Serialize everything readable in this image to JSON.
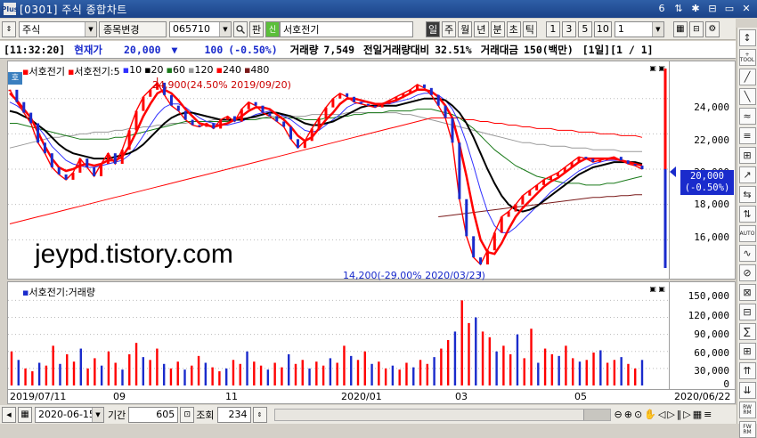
{
  "window": {
    "title": "[0301] 주식 종합차트",
    "logo": "Plus",
    "buttons": [
      "6",
      "⇅",
      "✱",
      "⊟",
      "▭",
      "✕"
    ]
  },
  "toolbar": {
    "market": "주식",
    "stock_change_label": "종목변경",
    "code": "065710",
    "pan_label": "판",
    "sin_label": "신",
    "stock_name": "서호전기",
    "periods": [
      "일",
      "주",
      "월",
      "년",
      "분",
      "초",
      "틱"
    ],
    "active_period": "일",
    "numbers": [
      "1",
      "3",
      "5",
      "10"
    ],
    "interval_value": "1"
  },
  "info": {
    "time": "[11:32:20]",
    "price_label": "현재가",
    "price": "20,000",
    "change_arrow": "▼",
    "change": "100",
    "change_pct": "(-0.50%)",
    "volume_label": "거래량",
    "volume": "7,549",
    "prev_vol_label": "전일거래량대비",
    "prev_vol_pct": "32.51%",
    "amount_label": "거래대금",
    "amount": "150(백만)",
    "page": "[1일][1 / 1]"
  },
  "legend": {
    "stock1": "서호전기",
    "stock2": "서호전기:5",
    "ma": [
      {
        "label": "10",
        "color": "#3030ff"
      },
      {
        "label": "20",
        "color": "#000000"
      },
      {
        "label": "60",
        "color": "#1a7a1a"
      },
      {
        "label": "120",
        "color": "#999999"
      },
      {
        "label": "240",
        "color": "#ff0000"
      },
      {
        "label": "480",
        "color": "#7a1a1a"
      }
    ],
    "ho_label": "호"
  },
  "annotations": {
    "high": "24,900(24.50% 2019/09/20)",
    "low": "14,200(-29.00% 2020/03/23)"
  },
  "current_badge": {
    "price": "20,000",
    "pct": "(-0.50%)"
  },
  "price_axis": [
    "24,000",
    "22,000",
    "20,000",
    "18,000",
    "16,000"
  ],
  "volume_panel": {
    "title": "서호전기:거래량",
    "axis": [
      "150,000",
      "120,000",
      "90,000",
      "60,000",
      "30,000",
      "0"
    ]
  },
  "date_axis": [
    "2019/07/11",
    "09",
    "11",
    "2020/01",
    "03",
    "05",
    "2020/06/22"
  ],
  "watermark": "jeypd.tistory.com",
  "bottom": {
    "date": "2020-06-15",
    "period_label": "기간",
    "period_value": "605",
    "view_label": "조회",
    "view_value": "234"
  },
  "rightbar": [
    "↕",
    "+ TOOL",
    "╱",
    "╲",
    "≈",
    "≡",
    "⊞",
    "↗",
    "⇆",
    "⇅",
    "AUTO",
    "∿",
    "⊘",
    "⊠",
    "⊟",
    "∑",
    "⊞",
    "⇈",
    "⇊",
    "RW RM",
    "FW RM",
    "⊕",
    "⊖"
  ],
  "chart_data": {
    "type": "candlestick",
    "series": [
      {
        "name": "서호전기",
        "values": [
          24500,
          23800,
          23200,
          22600,
          21500,
          20900,
          20100,
          19700,
          19400,
          19800,
          20600,
          20100,
          19600,
          20300,
          20900,
          20300,
          21100,
          22200,
          23300,
          24100,
          24500,
          24900,
          24200,
          23600,
          23300,
          22800,
          22500,
          22400,
          22600,
          22300,
          22800,
          23000,
          22700,
          23400,
          23800,
          23600,
          23200,
          23000,
          22700,
          22400,
          21700,
          21200,
          21600,
          22300,
          22900,
          23500,
          24000,
          24300,
          24100,
          23800,
          23700,
          23600,
          23500,
          23700,
          23900,
          24100,
          24300,
          24500,
          24800,
          24600,
          24200,
          23600,
          22900,
          21500,
          18300,
          16200,
          15000,
          14600,
          15400,
          16400,
          17300,
          17600,
          18000,
          18500,
          18800,
          19100,
          19400,
          19600,
          19800,
          20100,
          20400,
          20700,
          20600,
          20400,
          20500,
          20600,
          20700,
          20500,
          20300,
          20200,
          20000
        ]
      },
      {
        "name": "서호전기:5",
        "values": [
          24300,
          23900,
          23400,
          22900,
          22100,
          21300,
          20600,
          20100,
          19900,
          20000,
          20200,
          20300,
          20200,
          20300,
          20500,
          20500,
          20700,
          21300,
          22100,
          23000,
          23700,
          24300,
          24500,
          24300,
          23900,
          23400,
          23000,
          22600,
          22500,
          22400,
          22500,
          22600,
          22800,
          23000,
          23300,
          23500,
          23500,
          23400,
          23100,
          22800,
          22400,
          21900,
          21600,
          21800,
          22300,
          22800,
          23200,
          23700,
          24000,
          24000,
          23900,
          23800,
          23700,
          23700,
          23800,
          23900,
          24100,
          24300,
          24500,
          24500,
          24400,
          24100,
          23600,
          22900,
          21400,
          19600,
          17600,
          16000,
          15300,
          15200,
          15800,
          16600,
          17300,
          17800,
          18200,
          18600,
          19000,
          19300,
          19500,
          19800,
          20100,
          20400,
          20600,
          20600,
          20600,
          20600,
          20600,
          20500,
          20400,
          20300,
          20200
        ]
      },
      {
        "name": "10",
        "values": [
          23800,
          23600,
          23300,
          22900,
          22400,
          21900,
          21300,
          20900,
          20500,
          20300,
          20200,
          20100,
          20100,
          20200,
          20300,
          20400,
          20500,
          20800,
          21300,
          21900,
          22500,
          23100,
          23500,
          23700,
          23700,
          23500,
          23200,
          22900,
          22700,
          22600,
          22500,
          22500,
          22600,
          22700,
          22900,
          23100,
          23200,
          23300,
          23200,
          23000,
          22800,
          22500,
          22200,
          22100,
          22200,
          22500,
          22800,
          23100,
          23500,
          23700,
          23800,
          23800,
          23700,
          23700,
          23700,
          23800,
          23900,
          24000,
          24200,
          24300,
          24300,
          24200,
          23900,
          23400,
          22600,
          21500,
          20200,
          18800,
          17600,
          16800,
          16400,
          16400,
          16700,
          17100,
          17500,
          17900,
          18300,
          18700,
          19000,
          19300,
          19600,
          19900,
          20100,
          20300,
          20400,
          20500,
          20500,
          20500,
          20400,
          20400,
          20300
        ]
      },
      {
        "name": "20",
        "values": [
          23300,
          23200,
          23000,
          22800,
          22500,
          22200,
          21800,
          21400,
          21100,
          20900,
          20800,
          20700,
          20600,
          20600,
          20600,
          20700,
          20800,
          20900,
          21100,
          21400,
          21800,
          22200,
          22600,
          22900,
          23100,
          23200,
          23200,
          23100,
          23000,
          22900,
          22800,
          22800,
          22800,
          22800,
          22900,
          23000,
          23100,
          23200,
          23200,
          23100,
          23000,
          22800,
          22600,
          22500,
          22500,
          22600,
          22700,
          22900,
          23100,
          23300,
          23500,
          23600,
          23600,
          23600,
          23600,
          23600,
          23700,
          23800,
          23900,
          24000,
          24000,
          24000,
          23900,
          23600,
          23200,
          22600,
          21800,
          20900,
          20000,
          19200,
          18500,
          18000,
          17700,
          17600,
          17700,
          17900,
          18200,
          18500,
          18800,
          19100,
          19400,
          19700,
          19900,
          20100,
          20200,
          20300,
          20400,
          20400,
          20400,
          20400,
          20300
        ]
      },
      {
        "name": "60",
        "values": [
          22600,
          22600,
          22500,
          22400,
          22300,
          22200,
          22100,
          22000,
          21900,
          21800,
          21700,
          21700,
          21700,
          21700,
          21700,
          21800,
          21800,
          21900,
          22000,
          22100,
          22200,
          22300,
          22400,
          22500,
          22600,
          22700,
          22700,
          22700,
          22700,
          22700,
          22700,
          22700,
          22800,
          22800,
          22800,
          22800,
          22900,
          22900,
          22900,
          22900,
          22900,
          22900,
          22800,
          22800,
          22800,
          22900,
          22900,
          23000,
          23000,
          23100,
          23100,
          23200,
          23200,
          23200,
          23300,
          23300,
          23300,
          23300,
          23400,
          23400,
          23400,
          23300,
          23200,
          23100,
          22900,
          22600,
          22300,
          21900,
          21500,
          21100,
          20800,
          20500,
          20200,
          20000,
          19800,
          19600,
          19500,
          19400,
          19300,
          19200,
          19200,
          19200,
          19100,
          19100,
          19100,
          19200,
          19200,
          19300,
          19400,
          19500,
          19600
        ]
      },
      {
        "name": "120",
        "values": [
          21200,
          21300,
          21400,
          21500,
          21600,
          21700,
          21800,
          21800,
          21900,
          21900,
          22000,
          22000,
          22100,
          22100,
          22100,
          22200,
          22200,
          22300,
          22300,
          22400,
          22400,
          22500,
          22500,
          22600,
          22600,
          22600,
          22700,
          22700,
          22700,
          22800,
          22800,
          22800,
          22800,
          22900,
          22900,
          22900,
          22900,
          23000,
          23000,
          23000,
          23000,
          23000,
          23000,
          23100,
          23100,
          23100,
          23100,
          23100,
          23200,
          23200,
          23200,
          23200,
          23200,
          23200,
          23200,
          23200,
          23100,
          23100,
          23000,
          22900,
          22800,
          22700,
          22600,
          22500,
          22400,
          22300,
          22200,
          22100,
          22000,
          21900,
          21800,
          21700,
          21600,
          21500,
          21500,
          21400,
          21400,
          21300,
          21300,
          21300,
          21200,
          21200,
          21200,
          21100,
          21100,
          21100,
          21100,
          21000,
          21000,
          21000,
          21000
        ]
      },
      {
        "name": "240",
        "values": [
          16900,
          17000,
          17100,
          17200,
          17300,
          17400,
          17500,
          17600,
          17700,
          17800,
          17900,
          18000,
          18100,
          18200,
          18300,
          18400,
          18500,
          18600,
          18700,
          18800,
          18900,
          19000,
          19100,
          19200,
          19300,
          19400,
          19500,
          19600,
          19700,
          19800,
          19900,
          20000,
          20100,
          20200,
          20300,
          20400,
          20500,
          20600,
          20700,
          20800,
          20900,
          21000,
          21100,
          21200,
          21300,
          21400,
          21500,
          21600,
          21700,
          21800,
          21900,
          22000,
          22100,
          22200,
          22300,
          22400,
          22500,
          22600,
          22700,
          22800,
          22900,
          22900,
          22900,
          22900,
          22900,
          22800,
          22800,
          22700,
          22700,
          22600,
          22600,
          22500,
          22500,
          22400,
          22400,
          22300,
          22300,
          22300,
          22200,
          22200,
          22200,
          22100,
          22100,
          22100,
          22000,
          22000,
          22000,
          21900,
          21900,
          21900,
          21800
        ]
      },
      {
        "name": "480",
        "values": [
          null,
          null,
          null,
          null,
          null,
          null,
          null,
          null,
          null,
          null,
          null,
          null,
          null,
          null,
          null,
          null,
          null,
          null,
          null,
          null,
          null,
          null,
          null,
          null,
          null,
          null,
          null,
          null,
          null,
          null,
          null,
          null,
          null,
          null,
          null,
          null,
          null,
          null,
          null,
          null,
          null,
          null,
          null,
          null,
          null,
          null,
          null,
          null,
          null,
          null,
          null,
          null,
          null,
          null,
          null,
          null,
          null,
          null,
          null,
          null,
          null,
          17300,
          17350,
          17400,
          17450,
          17500,
          17550,
          17600,
          17650,
          17700,
          17750,
          17800,
          17850,
          17900,
          17950,
          18000,
          18050,
          18100,
          18150,
          18200,
          18250,
          18300,
          18350,
          18400,
          18400,
          18450,
          18450,
          18500,
          18500,
          18550,
          18550
        ]
      }
    ],
    "volume": [
      60,
      45,
      30,
      25,
      40,
      35,
      70,
      38,
      55,
      42,
      65,
      30,
      48,
      35,
      60,
      40,
      28,
      55,
      75,
      50,
      45,
      65,
      38,
      30,
      42,
      28,
      35,
      52,
      40,
      32,
      25,
      30,
      45,
      38,
      60,
      42,
      35,
      28,
      40,
      32,
      55,
      38,
      45,
      30,
      42,
      35,
      48,
      40,
      70,
      52,
      45,
      60,
      38,
      42,
      30,
      35,
      28,
      40,
      32,
      45,
      38,
      50,
      65,
      80,
      95,
      150,
      110,
      120,
      95,
      85,
      60,
      70,
      55,
      90,
      48,
      100,
      40,
      65,
      55,
      52,
      70,
      48,
      42,
      45,
      58,
      62,
      40,
      45,
      50,
      38,
      30,
      45
    ],
    "ylim": [
      14200,
      25500
    ],
    "ylim_volume": [
      0,
      160000
    ],
    "high": 24900,
    "low": 14200,
    "current": 20000
  }
}
